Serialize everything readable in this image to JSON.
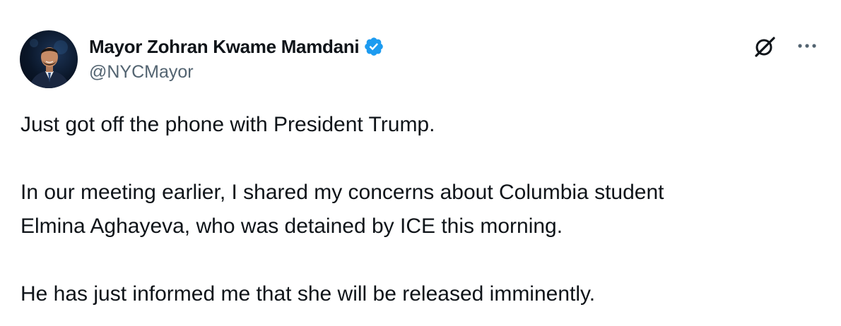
{
  "post": {
    "author": {
      "display_name": "Mayor Zohran Kwame Mamdani",
      "handle": "@NYCMayor",
      "verified": true,
      "verified_color": "#1d9bf0"
    },
    "body": {
      "line1": "Just got off the phone with President Trump.",
      "line2": "In our meeting earlier, I shared my concerns about Columbia student",
      "line3": "Elmina Aghayeva, who was detained by ICE this morning.",
      "line4": "He has just informed me that she will be released imminently."
    },
    "icons": {
      "verified": "verified-badge-icon",
      "grok": "grok-icon",
      "more": "more-options-icon"
    }
  }
}
